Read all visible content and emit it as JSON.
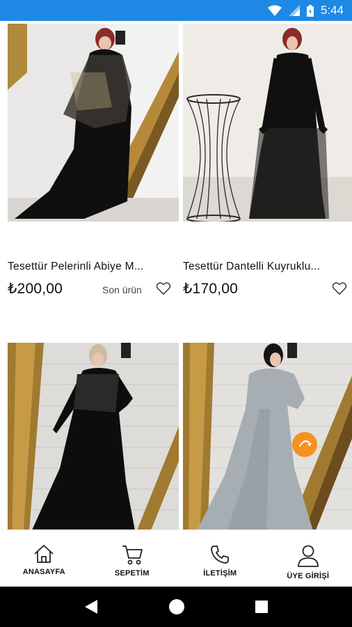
{
  "status_bar": {
    "time": "5:44"
  },
  "products": [
    {
      "name": "Tesettür Pelerinli Abiye M...",
      "price": "₺200,00",
      "badge": "Son ürün"
    },
    {
      "name": "Tesettür Dantelli Kuyruklu...",
      "price": "₺170,00",
      "badge": ""
    },
    {
      "name": "",
      "price": "",
      "badge": ""
    },
    {
      "name": "",
      "price": "",
      "badge": ""
    }
  ],
  "bottom_nav": {
    "items": [
      {
        "label": "ANASAYFA",
        "icon": "home-icon"
      },
      {
        "label": "SEPETİM",
        "icon": "cart-icon"
      },
      {
        "label": "İLETİŞİM",
        "icon": "phone-icon"
      },
      {
        "label": "ÜYE GİRİŞİ",
        "icon": "user-icon"
      }
    ]
  },
  "colors": {
    "status_bar": "#1e88e5",
    "fab": "#f5921f",
    "system_nav": "#000000"
  }
}
